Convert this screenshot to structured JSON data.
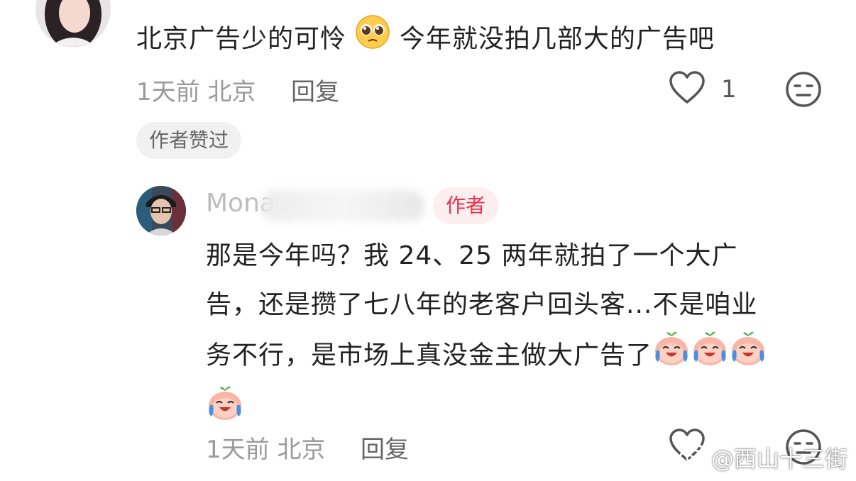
{
  "comment1": {
    "text_part1": "北京广告少的可怜",
    "emoji": "pleading-face",
    "text_part2": " 今年就没拍几部大的广告吧",
    "time": "1天前",
    "location": "北京",
    "reply_label": "回复",
    "like_count": "1",
    "author_liked_badge": "作者赞过"
  },
  "reply1": {
    "username": "Mona",
    "author_badge": "作者",
    "lines": [
      "那是今年吗？我 24、25 两年就拍了一个大广",
      "告，还是攒了七八年的老客户回头客...不是咱业",
      "务不行，是市场上真没金主做大广告了"
    ],
    "emoji": "crying-peach",
    "time": "1天前",
    "location": "北京",
    "reply_label": "回复"
  },
  "watermark": "@西山十三街",
  "colors": {
    "accent": "#e8334e",
    "meta": "#9a9a9a",
    "text": "#222222"
  }
}
